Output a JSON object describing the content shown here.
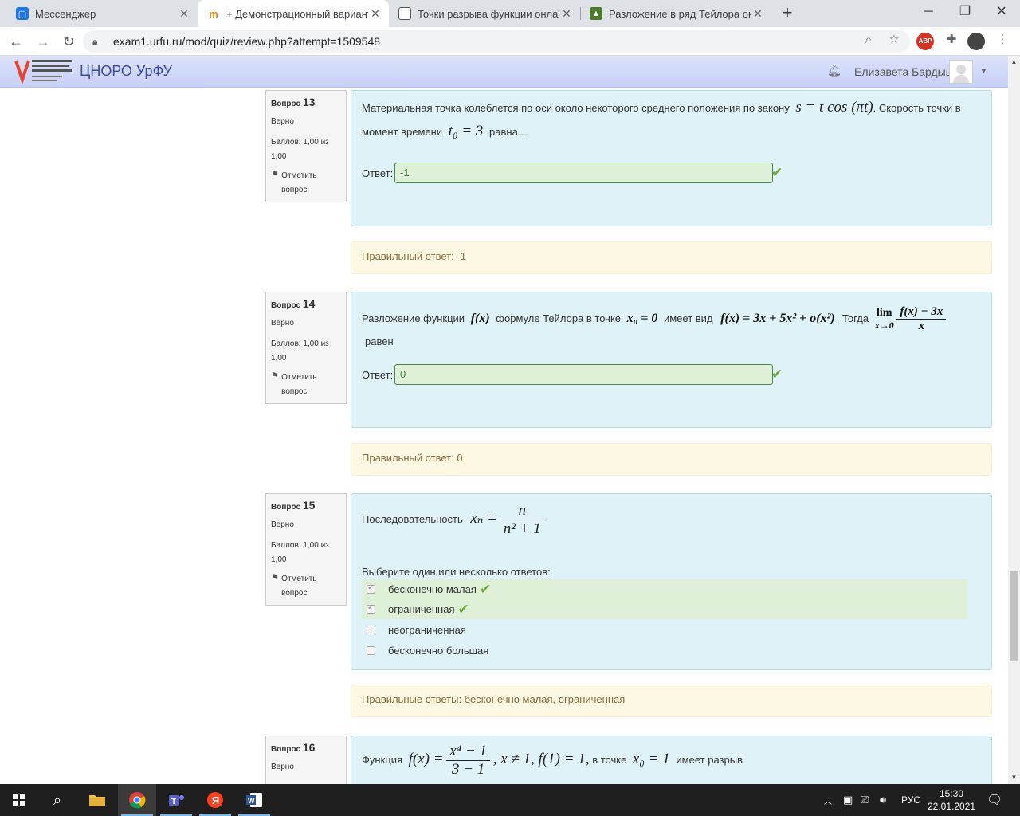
{
  "browser": {
    "tabs": [
      {
        "title": "Мессенджер",
        "active": false
      },
      {
        "title": "+ Демонстрационный вариант",
        "active": true
      },
      {
        "title": "Точки разрыва функции онлайн",
        "active": false
      },
      {
        "title": "Разложение в ряд Тейлора онлайн",
        "active": false
      }
    ],
    "url": "exam1.urfu.ru/mod/quiz/review.php?attempt=1509548",
    "abp_label": "ABP"
  },
  "header": {
    "logo_text": "Уральский федеральный университет",
    "site_name": "ЦНОРО УрФУ",
    "user_name": "Елизавета Бардыш"
  },
  "questions": [
    {
      "label": "Вопрос",
      "number": "13",
      "state": "Верно",
      "grade": "Баллов: 1,00 из 1,00",
      "flag": "Отметить вопрос",
      "text_before": "Материальная точка колеблется по оси около некоторого среднего положения по закону",
      "formula_1": "s = t cos (πt)",
      "text_mid": ". Скорость точки в",
      "text_line2": "момент времени",
      "formula_2": "t₀ = 3",
      "text_end": "равна ...",
      "answer_label": "Ответ:",
      "answer_value": "-1",
      "feedback": "Правильный ответ: -1"
    },
    {
      "label": "Вопрос",
      "number": "14",
      "state": "Верно",
      "grade": "Баллов: 1,00 из 1,00",
      "flag": "Отметить вопрос",
      "text_1": "Разложение функции",
      "formula_f": "f(x)",
      "text_2": "формуле Тейлора в точке",
      "formula_x0": "x₀ = 0",
      "text_3": "имеет вид",
      "formula_expansion": "f(x) = 3x + 5x² + o(x²)",
      "text_4": ". Тогда",
      "formula_lim": "lim",
      "formula_lim_sub": "x→0",
      "formula_num": "f(x) − 3x",
      "formula_den": "x",
      "text_end": "равен",
      "answer_label": "Ответ:",
      "answer_value": "0",
      "feedback": "Правильный ответ: 0"
    },
    {
      "label": "Вопрос",
      "number": "15",
      "state": "Верно",
      "grade": "Баллов: 1,00 из 1,00",
      "flag": "Отметить вопрос",
      "text_1": "Последовательность",
      "formula_lhs": "xₙ =",
      "formula_num": "n",
      "formula_den": "n² + 1",
      "prompt": "Выберите один или несколько ответов:",
      "options": [
        {
          "label": "бесконечно малая",
          "checked": true
        },
        {
          "label": "ограниченная",
          "checked": true
        },
        {
          "label": "неограниченная",
          "checked": false
        },
        {
          "label": "бесконечно большая",
          "checked": false
        }
      ],
      "feedback": "Правильные ответы: бесконечно малая, ограниченная"
    },
    {
      "label": "Вопрос",
      "number": "16",
      "state": "Верно",
      "text_1": "Функция",
      "formula_lhs": "f(x) =",
      "formula_num": "x⁴ − 1",
      "formula_den": "3 − 1",
      "formula_rest": ", x ≠ 1, f(1) = 1,",
      "text_2": "в точке",
      "formula_x0": "x₀ = 1",
      "text_3": "имеет разрыв"
    }
  ],
  "taskbar": {
    "lang": "РУС",
    "time": "15:30",
    "date": "22.01.2021"
  }
}
